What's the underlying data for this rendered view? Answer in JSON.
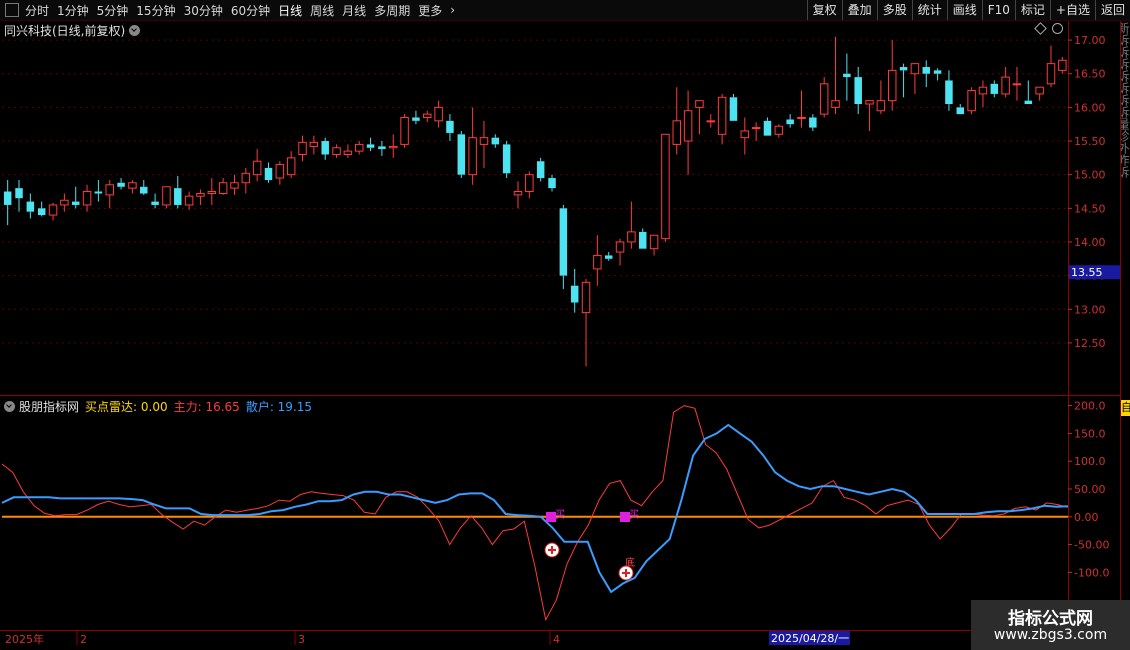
{
  "toolbar": {
    "periods": [
      "分时",
      "1分钟",
      "5分钟",
      "15分钟",
      "30分钟",
      "60分钟",
      "日线",
      "周线",
      "月线",
      "多周期",
      "更多"
    ],
    "active_period": "日线",
    "buttons": [
      "复权",
      "叠加",
      "多股",
      "统计",
      "画线",
      "F10",
      "标记",
      "+自选",
      "返回"
    ]
  },
  "stock": {
    "title": "同兴科技(日线,前复权)"
  },
  "colors": {
    "up": "#ff3b3b",
    "down": "#4de3f0",
    "grid": "#5a0000",
    "buy_radar": "#ffd700",
    "main": "#ff3b3b",
    "retail": "#3a9cff",
    "zero_line": "#ff8c00",
    "signal": "#e020e0"
  },
  "price_axis": {
    "ticks": [
      "17.00",
      "16.50",
      "16.00",
      "15.50",
      "15.00",
      "14.50",
      "14.00",
      "13.50",
      "13.00",
      "12.50"
    ],
    "ymin": 11.8,
    "ymax": 17.15,
    "current": "13.55"
  },
  "indicator": {
    "name": "股朋指标网",
    "buy_radar_label": "买点雷达: 0.00",
    "main_label": "主力: 16.65",
    "retail_label": "散户: 19.15",
    "ticks": [
      "200.0",
      "150.0",
      "100.0",
      "50.00",
      "0.00",
      "-50.00",
      "-100.0"
    ],
    "ymin": -200,
    "ymax": 210
  },
  "dates": {
    "year": "2025年",
    "months": [
      "2",
      "3",
      "4"
    ],
    "cursor": "2025/04/28/一"
  },
  "right_edge": {
    "text": "新诉诉诉诉诉诉诉量诊外昨诉",
    "tag": "自"
  },
  "signals": {
    "buy_label": "买",
    "bottom_label": "底"
  },
  "watermark": {
    "title": "指标公式网",
    "url": "www.zbgs3.com"
  },
  "chart_data": [
    {
      "type": "candlestick",
      "title": "同兴科技(日线,前复权)",
      "y_axis": [
        11.8,
        17.15
      ],
      "ohlc": [
        [
          14.75,
          14.92,
          14.25,
          14.55
        ],
        [
          14.8,
          14.92,
          14.45,
          14.65
        ],
        [
          14.6,
          14.72,
          14.35,
          14.45
        ],
        [
          14.5,
          14.6,
          14.38,
          14.4
        ],
        [
          14.4,
          14.58,
          14.32,
          14.55
        ],
        [
          14.55,
          14.72,
          14.45,
          14.62
        ],
        [
          14.6,
          14.82,
          14.5,
          14.55
        ],
        [
          14.55,
          14.85,
          14.45,
          14.75
        ],
        [
          14.75,
          14.92,
          14.6,
          14.72
        ],
        [
          14.7,
          14.92,
          14.5,
          14.85
        ],
        [
          14.88,
          14.95,
          14.78,
          14.82
        ],
        [
          14.8,
          14.92,
          14.72,
          14.88
        ],
        [
          14.82,
          14.92,
          14.7,
          14.72
        ],
        [
          14.6,
          14.72,
          14.5,
          14.55
        ],
        [
          14.55,
          14.8,
          14.5,
          14.82
        ],
        [
          14.8,
          14.98,
          14.5,
          14.55
        ],
        [
          14.55,
          14.75,
          14.48,
          14.68
        ],
        [
          14.68,
          14.78,
          14.55,
          14.72
        ],
        [
          14.72,
          14.95,
          14.55,
          14.75
        ],
        [
          14.72,
          14.95,
          14.7,
          14.88
        ],
        [
          14.8,
          15.0,
          14.7,
          14.88
        ],
        [
          14.88,
          15.1,
          14.72,
          15.02
        ],
        [
          15.0,
          15.38,
          14.9,
          15.2
        ],
        [
          15.1,
          15.18,
          14.88,
          14.92
        ],
        [
          14.95,
          15.2,
          14.85,
          15.15
        ],
        [
          15.0,
          15.35,
          14.95,
          15.25
        ],
        [
          15.3,
          15.58,
          15.2,
          15.48
        ],
        [
          15.42,
          15.58,
          15.3,
          15.48
        ],
        [
          15.5,
          15.55,
          15.22,
          15.3
        ],
        [
          15.3,
          15.45,
          15.25,
          15.4
        ],
        [
          15.3,
          15.45,
          15.25,
          15.35
        ],
        [
          15.35,
          15.5,
          15.3,
          15.45
        ],
        [
          15.45,
          15.55,
          15.35,
          15.4
        ],
        [
          15.42,
          15.5,
          15.28,
          15.38
        ],
        [
          15.4,
          15.6,
          15.25,
          15.42
        ],
        [
          15.45,
          15.9,
          15.4,
          15.85
        ],
        [
          15.85,
          15.95,
          15.75,
          15.8
        ],
        [
          15.85,
          15.95,
          15.78,
          15.9
        ],
        [
          15.8,
          16.1,
          15.7,
          16.0
        ],
        [
          15.8,
          15.9,
          15.5,
          15.62
        ],
        [
          15.6,
          15.65,
          14.95,
          15.0
        ],
        [
          15.0,
          16.0,
          14.85,
          15.55
        ],
        [
          15.45,
          15.8,
          15.1,
          15.55
        ],
        [
          15.55,
          15.6,
          15.4,
          15.45
        ],
        [
          15.45,
          15.5,
          14.95,
          15.02
        ],
        [
          14.7,
          14.9,
          14.5,
          14.75
        ],
        [
          14.75,
          15.05,
          14.65,
          15.0
        ],
        [
          15.2,
          15.25,
          14.9,
          14.95
        ],
        [
          14.95,
          15.0,
          14.75,
          14.8
        ],
        [
          14.5,
          14.55,
          13.3,
          13.5
        ],
        [
          13.35,
          13.6,
          12.95,
          13.1
        ],
        [
          12.95,
          13.45,
          12.15,
          13.4
        ],
        [
          13.6,
          14.1,
          13.35,
          13.8
        ],
        [
          13.8,
          13.85,
          13.72,
          13.75
        ],
        [
          13.85,
          14.05,
          13.65,
          14.0
        ],
        [
          14.0,
          14.6,
          13.9,
          14.15
        ],
        [
          14.15,
          14.2,
          13.9,
          13.9
        ],
        [
          13.9,
          14.0,
          13.8,
          14.1
        ],
        [
          14.05,
          15.6,
          14.0,
          15.6
        ],
        [
          15.45,
          16.3,
          15.3,
          15.8
        ],
        [
          15.5,
          16.25,
          15.0,
          15.95
        ],
        [
          16.0,
          16.1,
          15.6,
          16.1
        ],
        [
          15.8,
          15.9,
          15.7,
          15.8
        ],
        [
          15.6,
          16.2,
          15.45,
          16.15
        ],
        [
          16.15,
          16.2,
          15.8,
          15.8
        ],
        [
          15.55,
          15.85,
          15.3,
          15.65
        ],
        [
          15.7,
          15.78,
          15.5,
          15.7
        ],
        [
          15.8,
          15.85,
          15.58,
          15.58
        ],
        [
          15.6,
          15.75,
          15.55,
          15.72
        ],
        [
          15.82,
          15.9,
          15.7,
          15.75
        ],
        [
          15.85,
          16.25,
          15.7,
          15.85
        ],
        [
          15.85,
          15.9,
          15.65,
          15.7
        ],
        [
          15.9,
          16.45,
          15.85,
          16.35
        ],
        [
          16.0,
          17.05,
          15.9,
          16.1
        ],
        [
          16.5,
          16.8,
          16.1,
          16.45
        ],
        [
          16.45,
          16.6,
          15.9,
          16.05
        ],
        [
          16.05,
          16.1,
          15.65,
          16.1
        ],
        [
          15.95,
          16.4,
          15.9,
          16.1
        ],
        [
          16.1,
          17.0,
          15.95,
          16.55
        ],
        [
          16.6,
          16.65,
          16.15,
          16.55
        ],
        [
          16.5,
          16.6,
          16.2,
          16.65
        ],
        [
          16.6,
          16.7,
          16.3,
          16.5
        ],
        [
          16.55,
          16.58,
          16.4,
          16.5
        ],
        [
          16.4,
          16.55,
          15.95,
          16.05
        ],
        [
          16.0,
          16.05,
          15.9,
          15.9
        ],
        [
          15.95,
          16.3,
          15.9,
          16.25
        ],
        [
          16.2,
          16.4,
          16.0,
          16.3
        ],
        [
          16.35,
          16.4,
          16.15,
          16.2
        ],
        [
          16.2,
          16.6,
          16.15,
          16.45
        ],
        [
          16.35,
          16.6,
          16.1,
          16.35
        ],
        [
          16.1,
          16.4,
          16.05,
          16.05
        ],
        [
          16.2,
          16.3,
          16.1,
          16.3
        ],
        [
          16.35,
          16.92,
          16.3,
          16.65
        ],
        [
          16.55,
          16.75,
          16.5,
          16.7
        ]
      ]
    },
    {
      "type": "line",
      "title": "股朋指标网",
      "y_axis": [
        -200,
        210
      ],
      "series": [
        {
          "name": "主力",
          "color": "#ff3b3b",
          "values": [
            95,
            80,
            45,
            20,
            6,
            2,
            4,
            4,
            12,
            22,
            28,
            22,
            18,
            20,
            22,
            4,
            -10,
            -22,
            -8,
            -15,
            0,
            12,
            8,
            12,
            15,
            20,
            30,
            28,
            40,
            45,
            42,
            40,
            38,
            30,
            8,
            5,
            35,
            45,
            45,
            35,
            15,
            -8,
            -50,
            -20,
            2,
            -20,
            -50,
            -25,
            -22,
            -8,
            -90,
            -185,
            -150,
            -85,
            -45,
            -15,
            30,
            60,
            65,
            30,
            20,
            45,
            65,
            188,
            200,
            195,
            130,
            115,
            85,
            40,
            -5,
            -20,
            -15,
            -5,
            5,
            15,
            25,
            55,
            65,
            35,
            30,
            20,
            5,
            20,
            25,
            30,
            22,
            -15,
            -40,
            -20,
            5,
            5,
            3,
            2,
            5,
            15,
            18,
            12,
            25,
            22,
            17
          ]
        },
        {
          "name": "散户",
          "color": "#3a9cff",
          "values": [
            25,
            35,
            35,
            35,
            35,
            33,
            33,
            33,
            33,
            33,
            33,
            32,
            30,
            22,
            15,
            15,
            15,
            5,
            3,
            3,
            3,
            3,
            5,
            10,
            12,
            18,
            22,
            28,
            28,
            30,
            40,
            45,
            45,
            40,
            40,
            35,
            30,
            25,
            30,
            40,
            42,
            42,
            30,
            5,
            3,
            2,
            0,
            -20,
            -45,
            -45,
            -45,
            -100,
            -135,
            -120,
            -110,
            -80,
            -60,
            -40,
            30,
            110,
            140,
            150,
            165,
            150,
            135,
            110,
            80,
            65,
            55,
            50,
            55,
            55,
            50,
            45,
            40,
            45,
            50,
            45,
            30,
            5,
            5,
            5,
            5,
            5,
            8,
            10,
            10,
            12,
            15,
            20,
            18,
            19
          ]
        },
        {
          "name": "买点雷达",
          "color": "#ffd700",
          "values": [
            0
          ]
        }
      ]
    }
  ]
}
